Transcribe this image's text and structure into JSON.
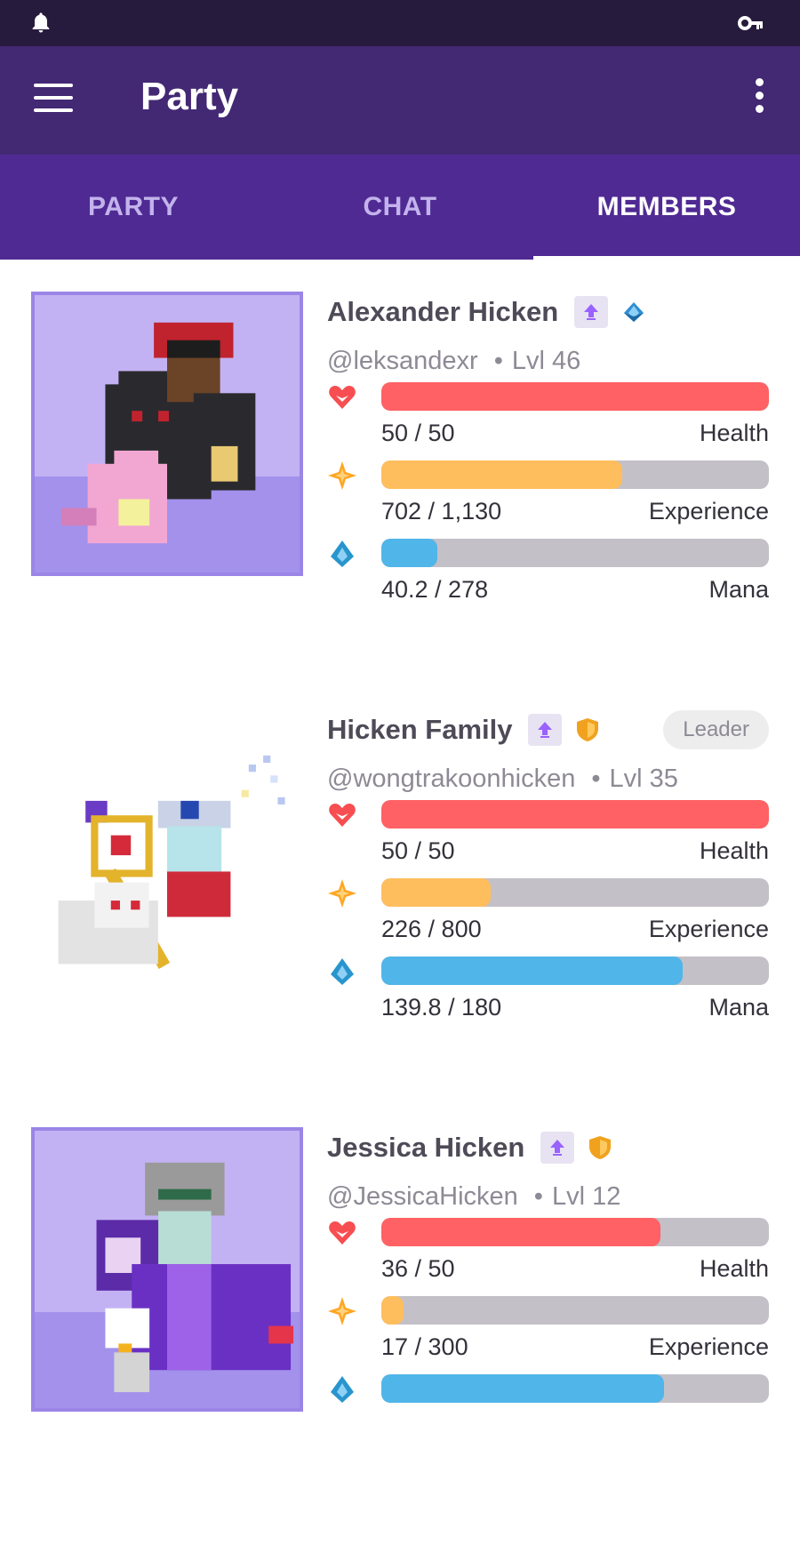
{
  "app": {
    "title": "Party"
  },
  "tabs": [
    {
      "label": "PARTY",
      "active": false
    },
    {
      "label": "CHAT",
      "active": false
    },
    {
      "label": "MEMBERS",
      "active": true
    }
  ],
  "colors": {
    "health": "#ff6165",
    "experience": "#ffbe5d",
    "mana": "#50b5e9",
    "header": "#432874",
    "tabs": "#4f2a93"
  },
  "members": [
    {
      "name": "Alexander Hicken",
      "handle": "@leksandexr",
      "level": "Lvl 46",
      "class_icon": "mage-crystal-icon",
      "leader": "",
      "stats": [
        {
          "value": "50 / 50",
          "label": "Health",
          "fraction": 1.0
        },
        {
          "value": "702 / 1,130",
          "label": "Experience",
          "fraction": 0.621
        },
        {
          "value": "40.2 / 278",
          "label": "Mana",
          "fraction": 0.145
        }
      ]
    },
    {
      "name": "Hicken Family",
      "handle": "@wongtrakoonhicken",
      "level": "Lvl 35",
      "class_icon": "healer-shield-icon",
      "leader": "Leader",
      "stats": [
        {
          "value": "50 / 50",
          "label": "Health",
          "fraction": 1.0
        },
        {
          "value": "226 / 800",
          "label": "Experience",
          "fraction": 0.2825
        },
        {
          "value": "139.8 / 180",
          "label": "Mana",
          "fraction": 0.777
        }
      ]
    },
    {
      "name": "Jessica Hicken",
      "handle": "@JessicaHicken",
      "level": "Lvl 12",
      "class_icon": "healer-shield-icon",
      "leader": "",
      "stats": [
        {
          "value": "36 / 50",
          "label": "Health",
          "fraction": 0.72
        },
        {
          "value": "17 / 300",
          "label": "Experience",
          "fraction": 0.057
        },
        {
          "value": "",
          "label": "",
          "fraction": 0.73
        }
      ]
    }
  ]
}
